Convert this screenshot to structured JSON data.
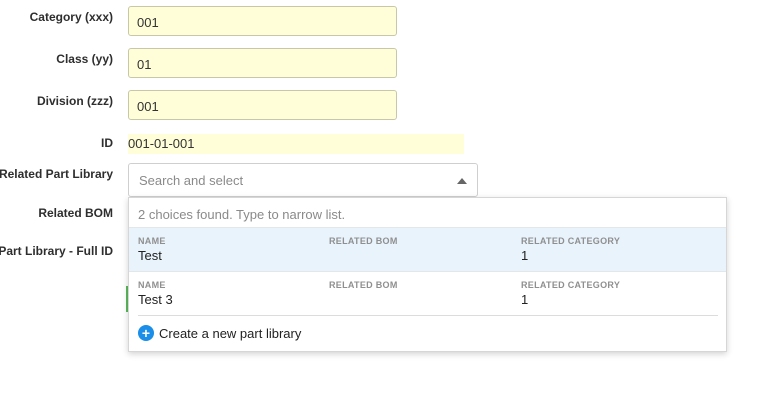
{
  "form": {
    "category": {
      "label": "Category (xxx)",
      "value": "001"
    },
    "class": {
      "label": "Class (yy)",
      "value": "01"
    },
    "division": {
      "label": "Division (zzz)",
      "value": "001"
    },
    "id": {
      "label": "ID",
      "value": "001-01-001"
    },
    "related_part_library": {
      "label": "Related Part Library",
      "placeholder": "Search and select"
    },
    "related_bom": {
      "label": "Related BOM"
    },
    "part_library_full_id": {
      "label": "Part Library - Full ID"
    }
  },
  "dropdown": {
    "hint": "2 choices found. Type to narrow list.",
    "options": [
      {
        "name_header": "NAME",
        "name": "Test",
        "bom_header": "RELATED BOM",
        "bom": "",
        "category_header": "RELATED CATEGORY",
        "category": "1"
      },
      {
        "name_header": "NAME",
        "name": "Test 3",
        "bom_header": "RELATED BOM",
        "bom": "",
        "category_header": "RELATED CATEGORY",
        "category": "1"
      }
    ],
    "create_label": "Create a new part library",
    "create_icon": "plus-circle-icon"
  },
  "colors": {
    "field_bg": "#fffed8",
    "highlight": "#e9f3fc",
    "accent": "#1a8ee8"
  }
}
